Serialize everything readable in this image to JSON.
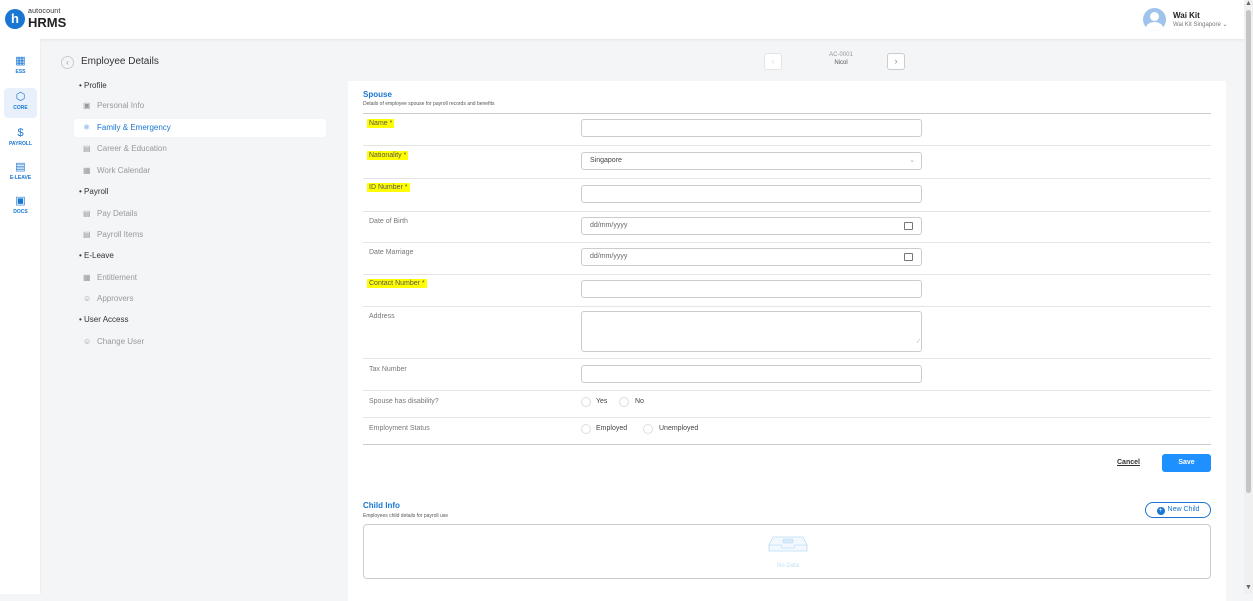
{
  "brand": {
    "top": "autocount",
    "main": "HRMS",
    "icon_letter": "h"
  },
  "user": {
    "name": "Wai Kit",
    "org": "Wai Kit Singapore ⌄"
  },
  "rail": [
    {
      "label": "ESS",
      "icon": "ess-icon",
      "glyph": "▦"
    },
    {
      "label": "CORE",
      "icon": "core-icon",
      "glyph": "⬡"
    },
    {
      "label": "PAYROLL",
      "icon": "payroll-icon",
      "glyph": "$"
    },
    {
      "label": "E-LEAVE",
      "icon": "calendar-icon",
      "glyph": "▤"
    },
    {
      "label": "DOCS",
      "icon": "docs-icon",
      "glyph": "▣"
    }
  ],
  "page": {
    "title": "Employee Details",
    "emp_code": "AC-0001",
    "emp_name": "Nicol"
  },
  "nav": {
    "profile": "Profile",
    "personal_info": "Personal Info",
    "family": "Family & Emergency",
    "career": "Career & Education",
    "work_calendar": "Work Calendar",
    "payroll": "Payroll",
    "pay_details": "Pay Details",
    "payroll_items": "Payroll Items",
    "eleave": "E-Leave",
    "entitlement": "Entitlement",
    "approvers": "Approvers",
    "user_access": "User Access",
    "change_user": "Change User"
  },
  "spouse": {
    "title": "Spouse",
    "desc": "Details of employee spouse for payroll records and benefits",
    "name_label": "Name *",
    "nationality_label": "Nationality *",
    "nationality_value": "Singapore",
    "id_label": "ID Number *",
    "dob_label": "Date of Birth",
    "date_placeholder": "dd/mm/yyyy",
    "marriage_label": "Date Marriage",
    "contact_label": "Contact Number *",
    "address_label": "Address",
    "tax_label": "Tax Number",
    "disability_label": "Spouse has disability?",
    "yes": "Yes",
    "no": "No",
    "employment_label": "Employment Status",
    "employed": "Employed",
    "unemployed": "Unemployed"
  },
  "actions": {
    "cancel": "Cancel",
    "save": "Save"
  },
  "child": {
    "title": "Child Info",
    "desc": "Employees child details for payroll use",
    "new_button": "New Child",
    "no_data": "No Data"
  },
  "colors": {
    "accent": "#1976d2",
    "highlight": "#ffff00",
    "save": "#1e90ff"
  }
}
